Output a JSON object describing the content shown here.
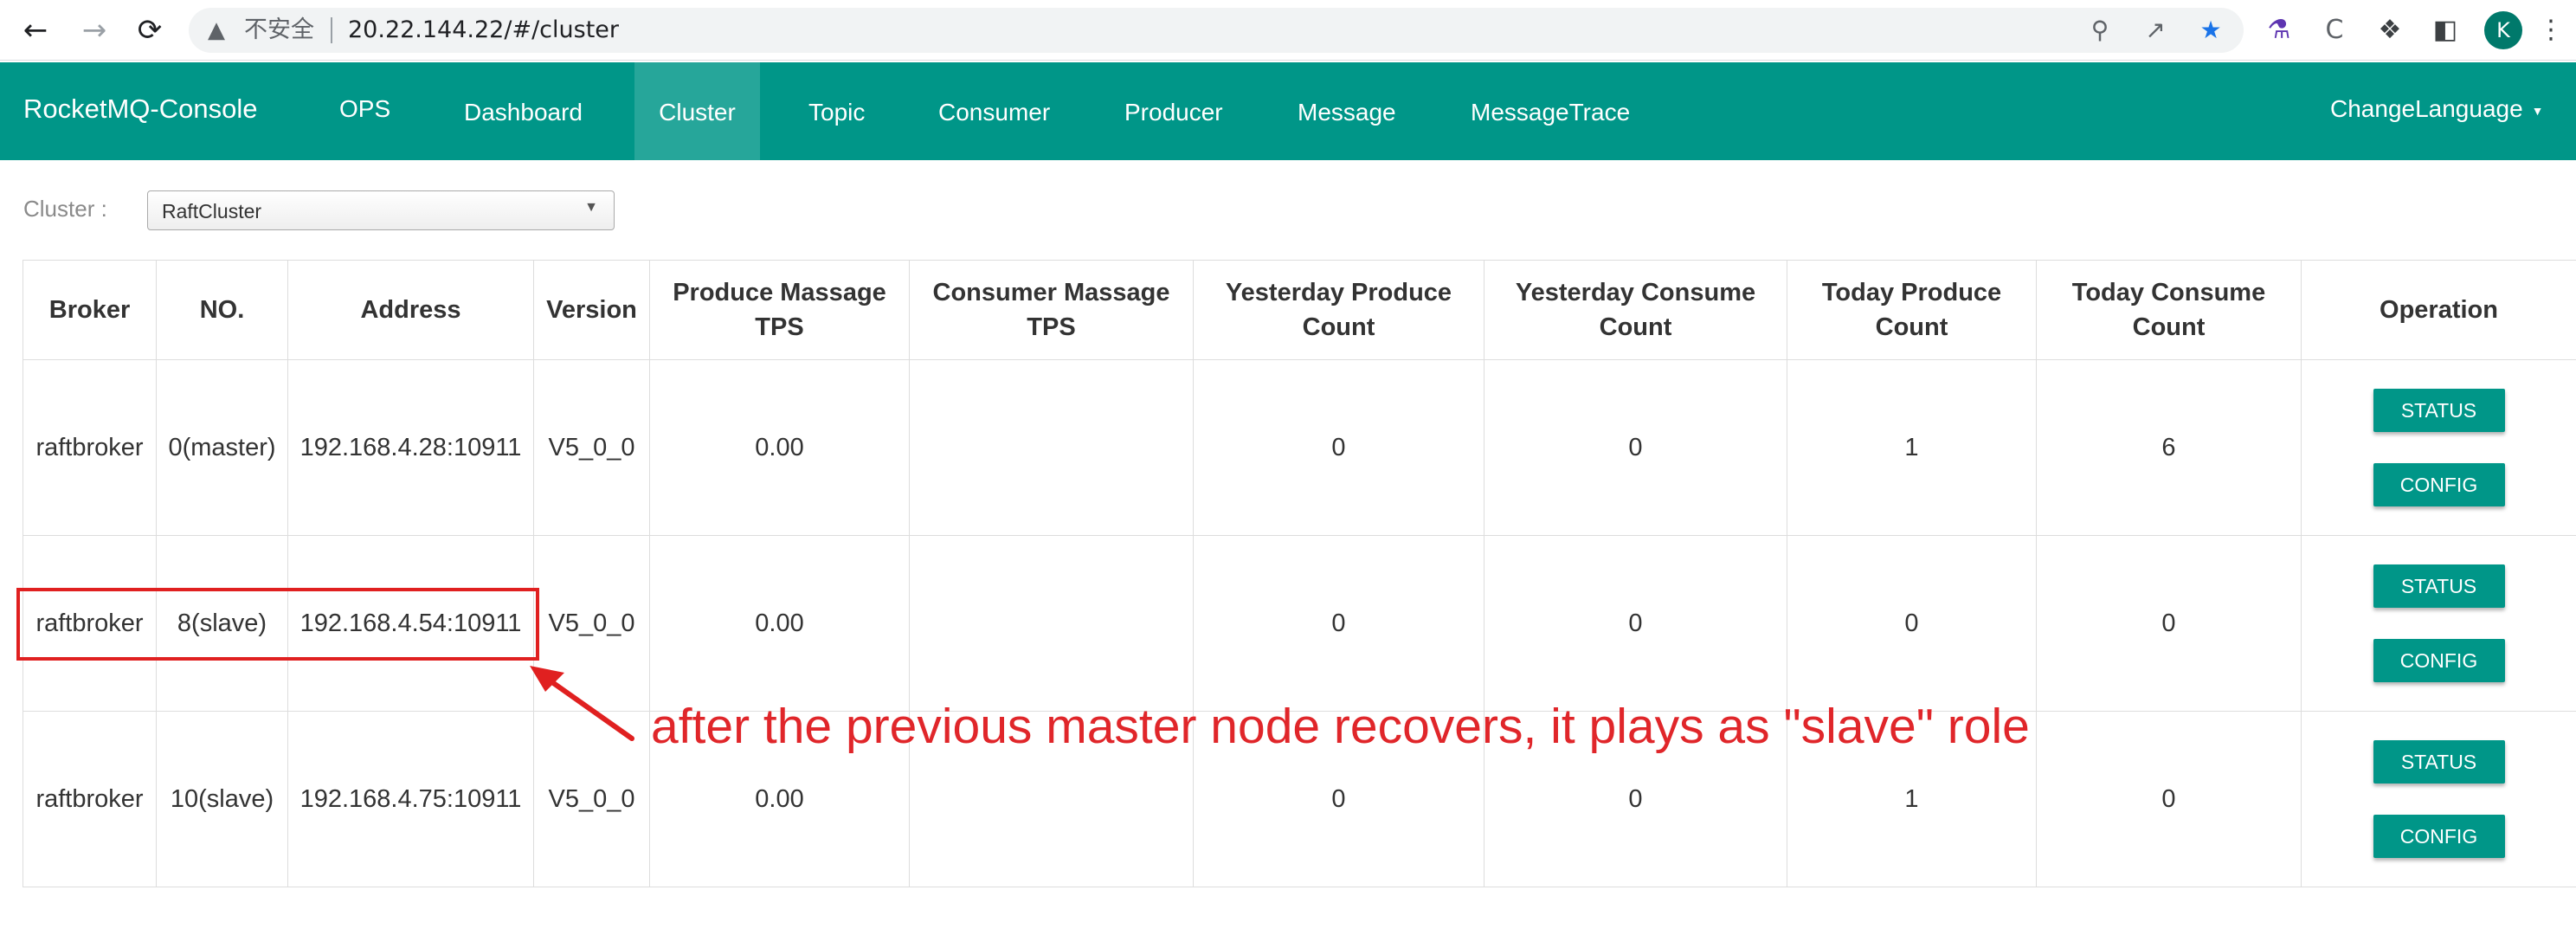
{
  "browser": {
    "insecure_label": "不安全",
    "url": "20.22.144.22/#/cluster",
    "profile_initial": "K",
    "icons": [
      "back-icon",
      "forward-icon",
      "reload-icon",
      "warning-icon",
      "zoom-icon",
      "share-icon",
      "star-icon",
      "labs-icon",
      "extension-c-icon",
      "puzzle-icon",
      "sidepanel-icon",
      "menu-icon"
    ]
  },
  "navbar": {
    "brand": "RocketMQ-Console",
    "items": [
      "OPS",
      "Dashboard",
      "Cluster",
      "Topic",
      "Consumer",
      "Producer",
      "Message",
      "MessageTrace"
    ],
    "active": "Cluster",
    "language": "ChangeLanguage",
    "color": "#009688"
  },
  "cluster_filter": {
    "label": "Cluster :",
    "selected": "RaftCluster"
  },
  "table": {
    "headers": [
      "Broker",
      "NO.",
      "Address",
      "Version",
      "Produce Massage TPS",
      "Consumer Massage TPS",
      "Yesterday Produce Count",
      "Yesterday Consume Count",
      "Today Produce Count",
      "Today Consume Count",
      "Operation"
    ],
    "rows": [
      {
        "broker": "raftbroker",
        "no": "0(master)",
        "address": "192.168.4.28:10911",
        "version": "V5_0_0",
        "produce_tps": "0.00",
        "consumer_tps": "",
        "yesterday_produce": "0",
        "yesterday_consume": "0",
        "today_produce": "1",
        "today_consume": "6"
      },
      {
        "broker": "raftbroker",
        "no": "8(slave)",
        "address": "192.168.4.54:10911",
        "version": "V5_0_0",
        "produce_tps": "0.00",
        "consumer_tps": "",
        "yesterday_produce": "0",
        "yesterday_consume": "0",
        "today_produce": "0",
        "today_consume": "0"
      },
      {
        "broker": "raftbroker",
        "no": "10(slave)",
        "address": "192.168.4.75:10911",
        "version": "V5_0_0",
        "produce_tps": "0.00",
        "consumer_tps": "",
        "yesterday_produce": "0",
        "yesterday_consume": "0",
        "today_produce": "1",
        "today_consume": "0"
      }
    ],
    "status_label": "STATUS",
    "config_label": "CONFIG"
  },
  "annotation": {
    "text": "after the previous master node recovers, it plays as \"slave\" role",
    "color": "#e0262a"
  }
}
